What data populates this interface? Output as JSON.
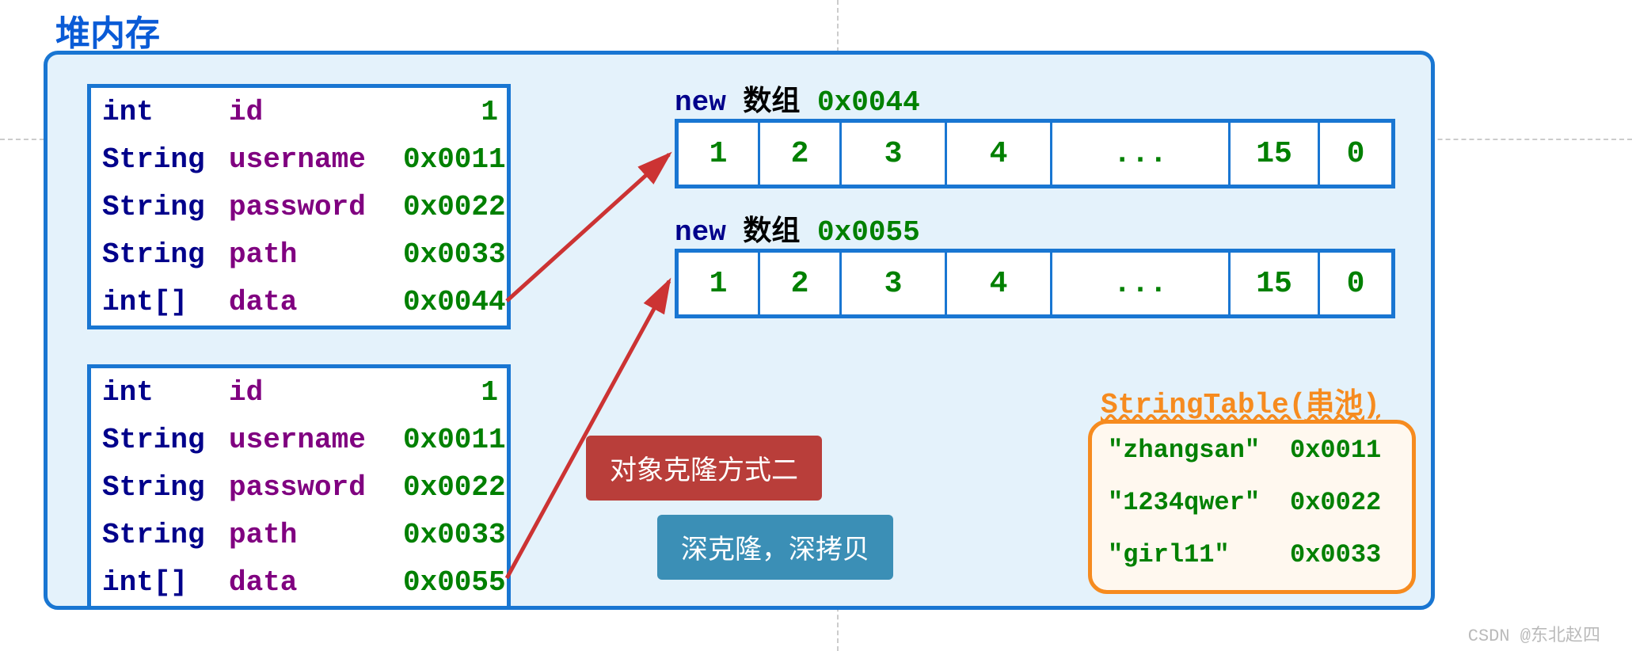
{
  "title": "堆内存",
  "obj1": {
    "rows": [
      {
        "type": "int",
        "name": "id",
        "val": "1"
      },
      {
        "type": "String",
        "name": "username",
        "val": "0x0011"
      },
      {
        "type": "String",
        "name": "password",
        "val": "0x0022"
      },
      {
        "type": "String",
        "name": "path",
        "val": "0x0033"
      },
      {
        "type": "int[]",
        "name": "data",
        "val": "0x0044"
      }
    ]
  },
  "obj2": {
    "rows": [
      {
        "type": "int",
        "name": "id",
        "val": "1"
      },
      {
        "type": "String",
        "name": "username",
        "val": "0x0011"
      },
      {
        "type": "String",
        "name": "password",
        "val": "0x0022"
      },
      {
        "type": "String",
        "name": "path",
        "val": "0x0033"
      },
      {
        "type": "int[]",
        "name": "data",
        "val": "0x0055"
      }
    ]
  },
  "arr1": {
    "kw": "new",
    "label": "数组",
    "addr": "0x0044",
    "cells": [
      "1",
      "2",
      "3",
      "4",
      "...",
      "15",
      "0"
    ]
  },
  "arr2": {
    "kw": "new",
    "label": "数组",
    "addr": "0x0055",
    "cells": [
      "1",
      "2",
      "3",
      "4",
      "...",
      "15",
      "0"
    ]
  },
  "tags": {
    "red": "对象克隆方式二",
    "blue": "深克隆，深拷贝"
  },
  "pool": {
    "title": "StringTable(串池)",
    "rows": [
      {
        "str": "\"zhangsan\"",
        "addr": "0x0011",
        "wavy": true
      },
      {
        "str": "\"1234qwer\"",
        "addr": "0x0022",
        "wavy": false
      },
      {
        "str": "\"girl11\"",
        "addr": "0x0033",
        "wavy": false
      }
    ]
  },
  "watermark": "CSDN @东北赵四"
}
